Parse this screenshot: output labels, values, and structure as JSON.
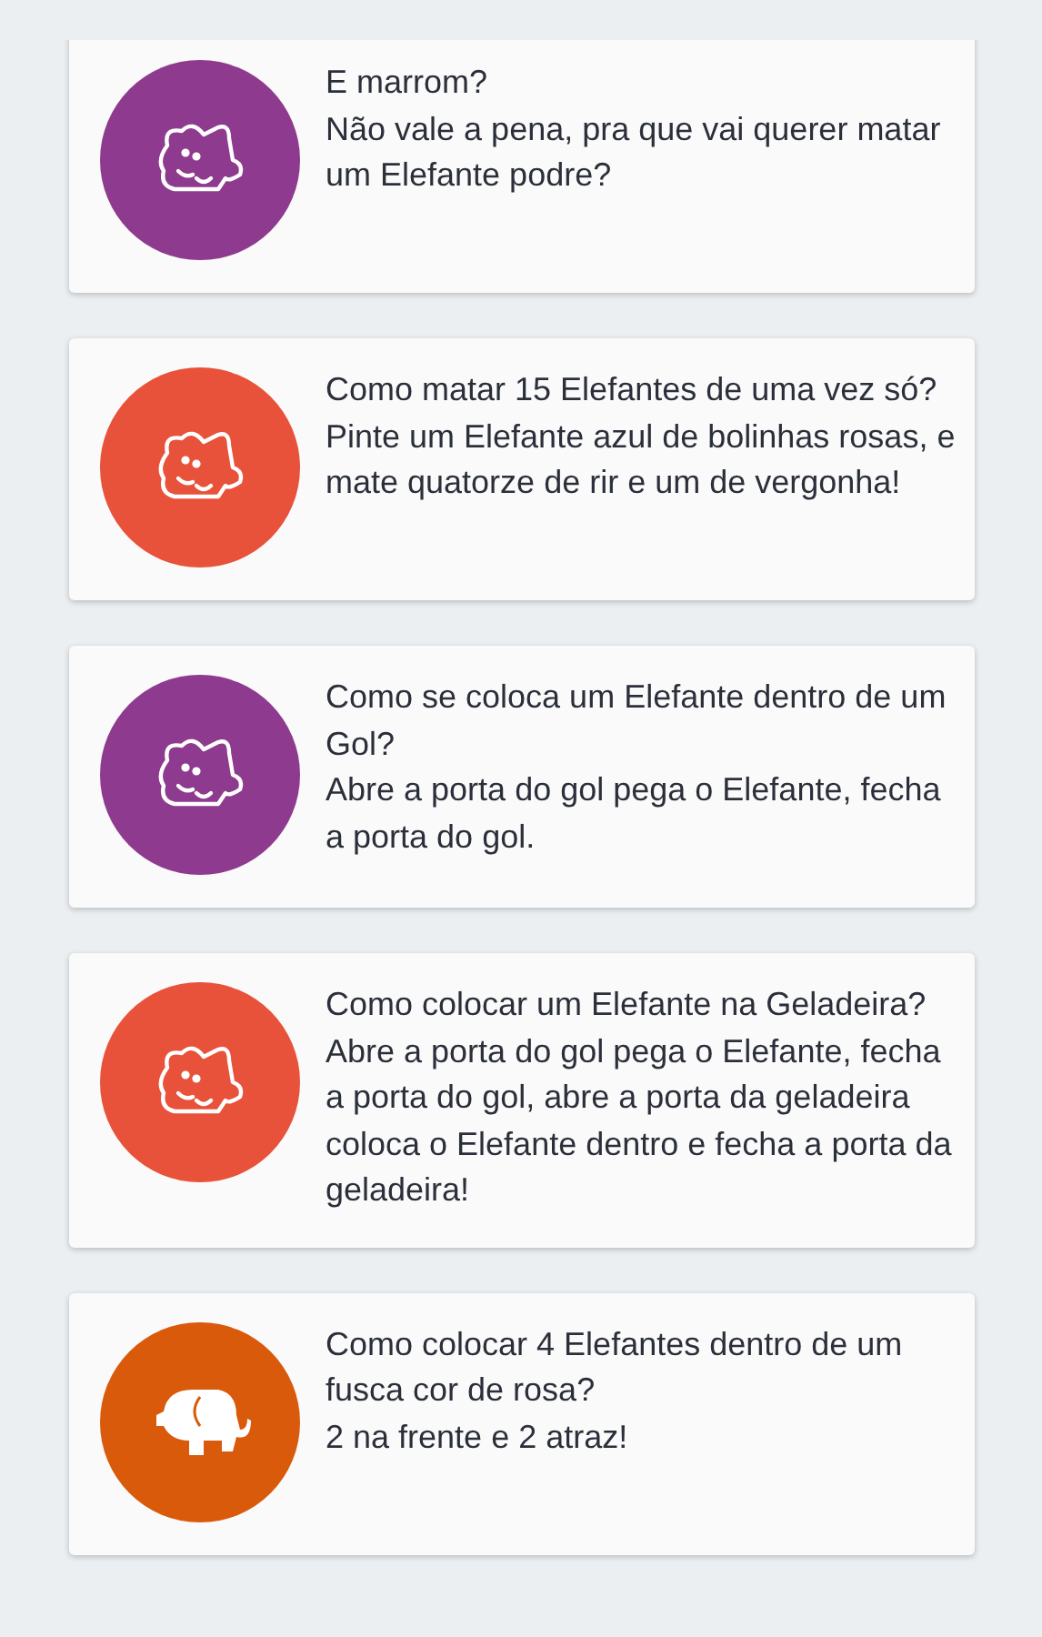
{
  "jokes": [
    {
      "icon": {
        "kind": "outline",
        "color": "#8e3a8e"
      },
      "question": "E marrom?",
      "answer": "Não vale a pena, pra que vai querer matar um Elefante podre?"
    },
    {
      "icon": {
        "kind": "outline",
        "color": "#e8523a"
      },
      "question": "Como matar 15 Elefantes de uma vez só?",
      "answer": "Pinte um Elefante azul de bolinhas rosas, e mate quatorze de rir e um de vergonha!"
    },
    {
      "icon": {
        "kind": "outline",
        "color": "#8e3a8e"
      },
      "question": "Como se coloca um Elefante dentro de um Gol?",
      "answer": "Abre a porta do gol pega o Elefante, fecha a porta do gol."
    },
    {
      "icon": {
        "kind": "outline",
        "color": "#e8523a"
      },
      "question": "Como colocar um Elefante na Geladeira?",
      "answer": "Abre a porta do gol pega o Elefante, fecha a porta do gol, abre a porta da geladeira coloca o Elefante dentro e fecha a porta da geladeira!"
    },
    {
      "icon": {
        "kind": "solid",
        "color": "#d95a0b"
      },
      "question": "Como colocar 4 Elefantes dentro de um fusca cor de rosa?",
      "answer": "2 na frente e 2 atraz!"
    }
  ]
}
